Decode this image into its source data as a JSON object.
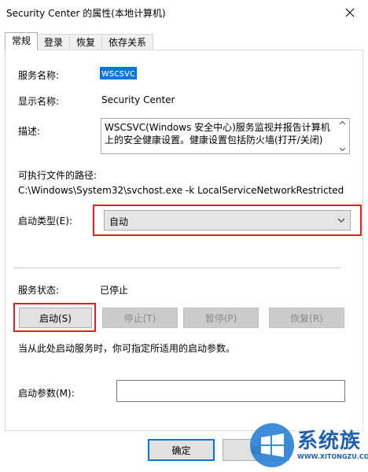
{
  "window": {
    "title": "Security Center 的属性(本地计算机)",
    "close_icon": "close-icon"
  },
  "tabs": [
    {
      "label": "常规"
    },
    {
      "label": "登录"
    },
    {
      "label": "恢复"
    },
    {
      "label": "依存关系"
    }
  ],
  "general": {
    "service_name_label": "服务名称:",
    "service_name_value": "wscsvc",
    "display_name_label": "显示名称:",
    "display_name_value": "Security Center",
    "description_label": "描述:",
    "description_value": "WSCSVC(Windows 安全中心)服务监视并报告计算机上的安全健康设置。健康设置包括防火墙(打开/关闭)",
    "exe_path_label": "可执行文件的路径:",
    "exe_path_value": "C:\\Windows\\System32\\svchost.exe -k LocalServiceNetworkRestricted",
    "startup_type_label": "启动类型(E):",
    "startup_type_value": "自动",
    "service_status_label": "服务状态:",
    "service_status_value": "已停止",
    "buttons": {
      "start": "启动(S)",
      "stop": "停止(T)",
      "pause": "暂停(P)",
      "resume": "恢复(R)"
    },
    "hint": "当从此处启动服务时，你可指定所适用的启动参数。",
    "start_params_label": "启动参数(M):",
    "start_params_value": ""
  },
  "footer": {
    "ok": "确定",
    "cancel": "取"
  },
  "watermark": {
    "brand": "系统族",
    "url": "WWW.XITONGZU.COM"
  },
  "colors": {
    "selection": "#0078d7",
    "highlight_border": "#e02020"
  }
}
